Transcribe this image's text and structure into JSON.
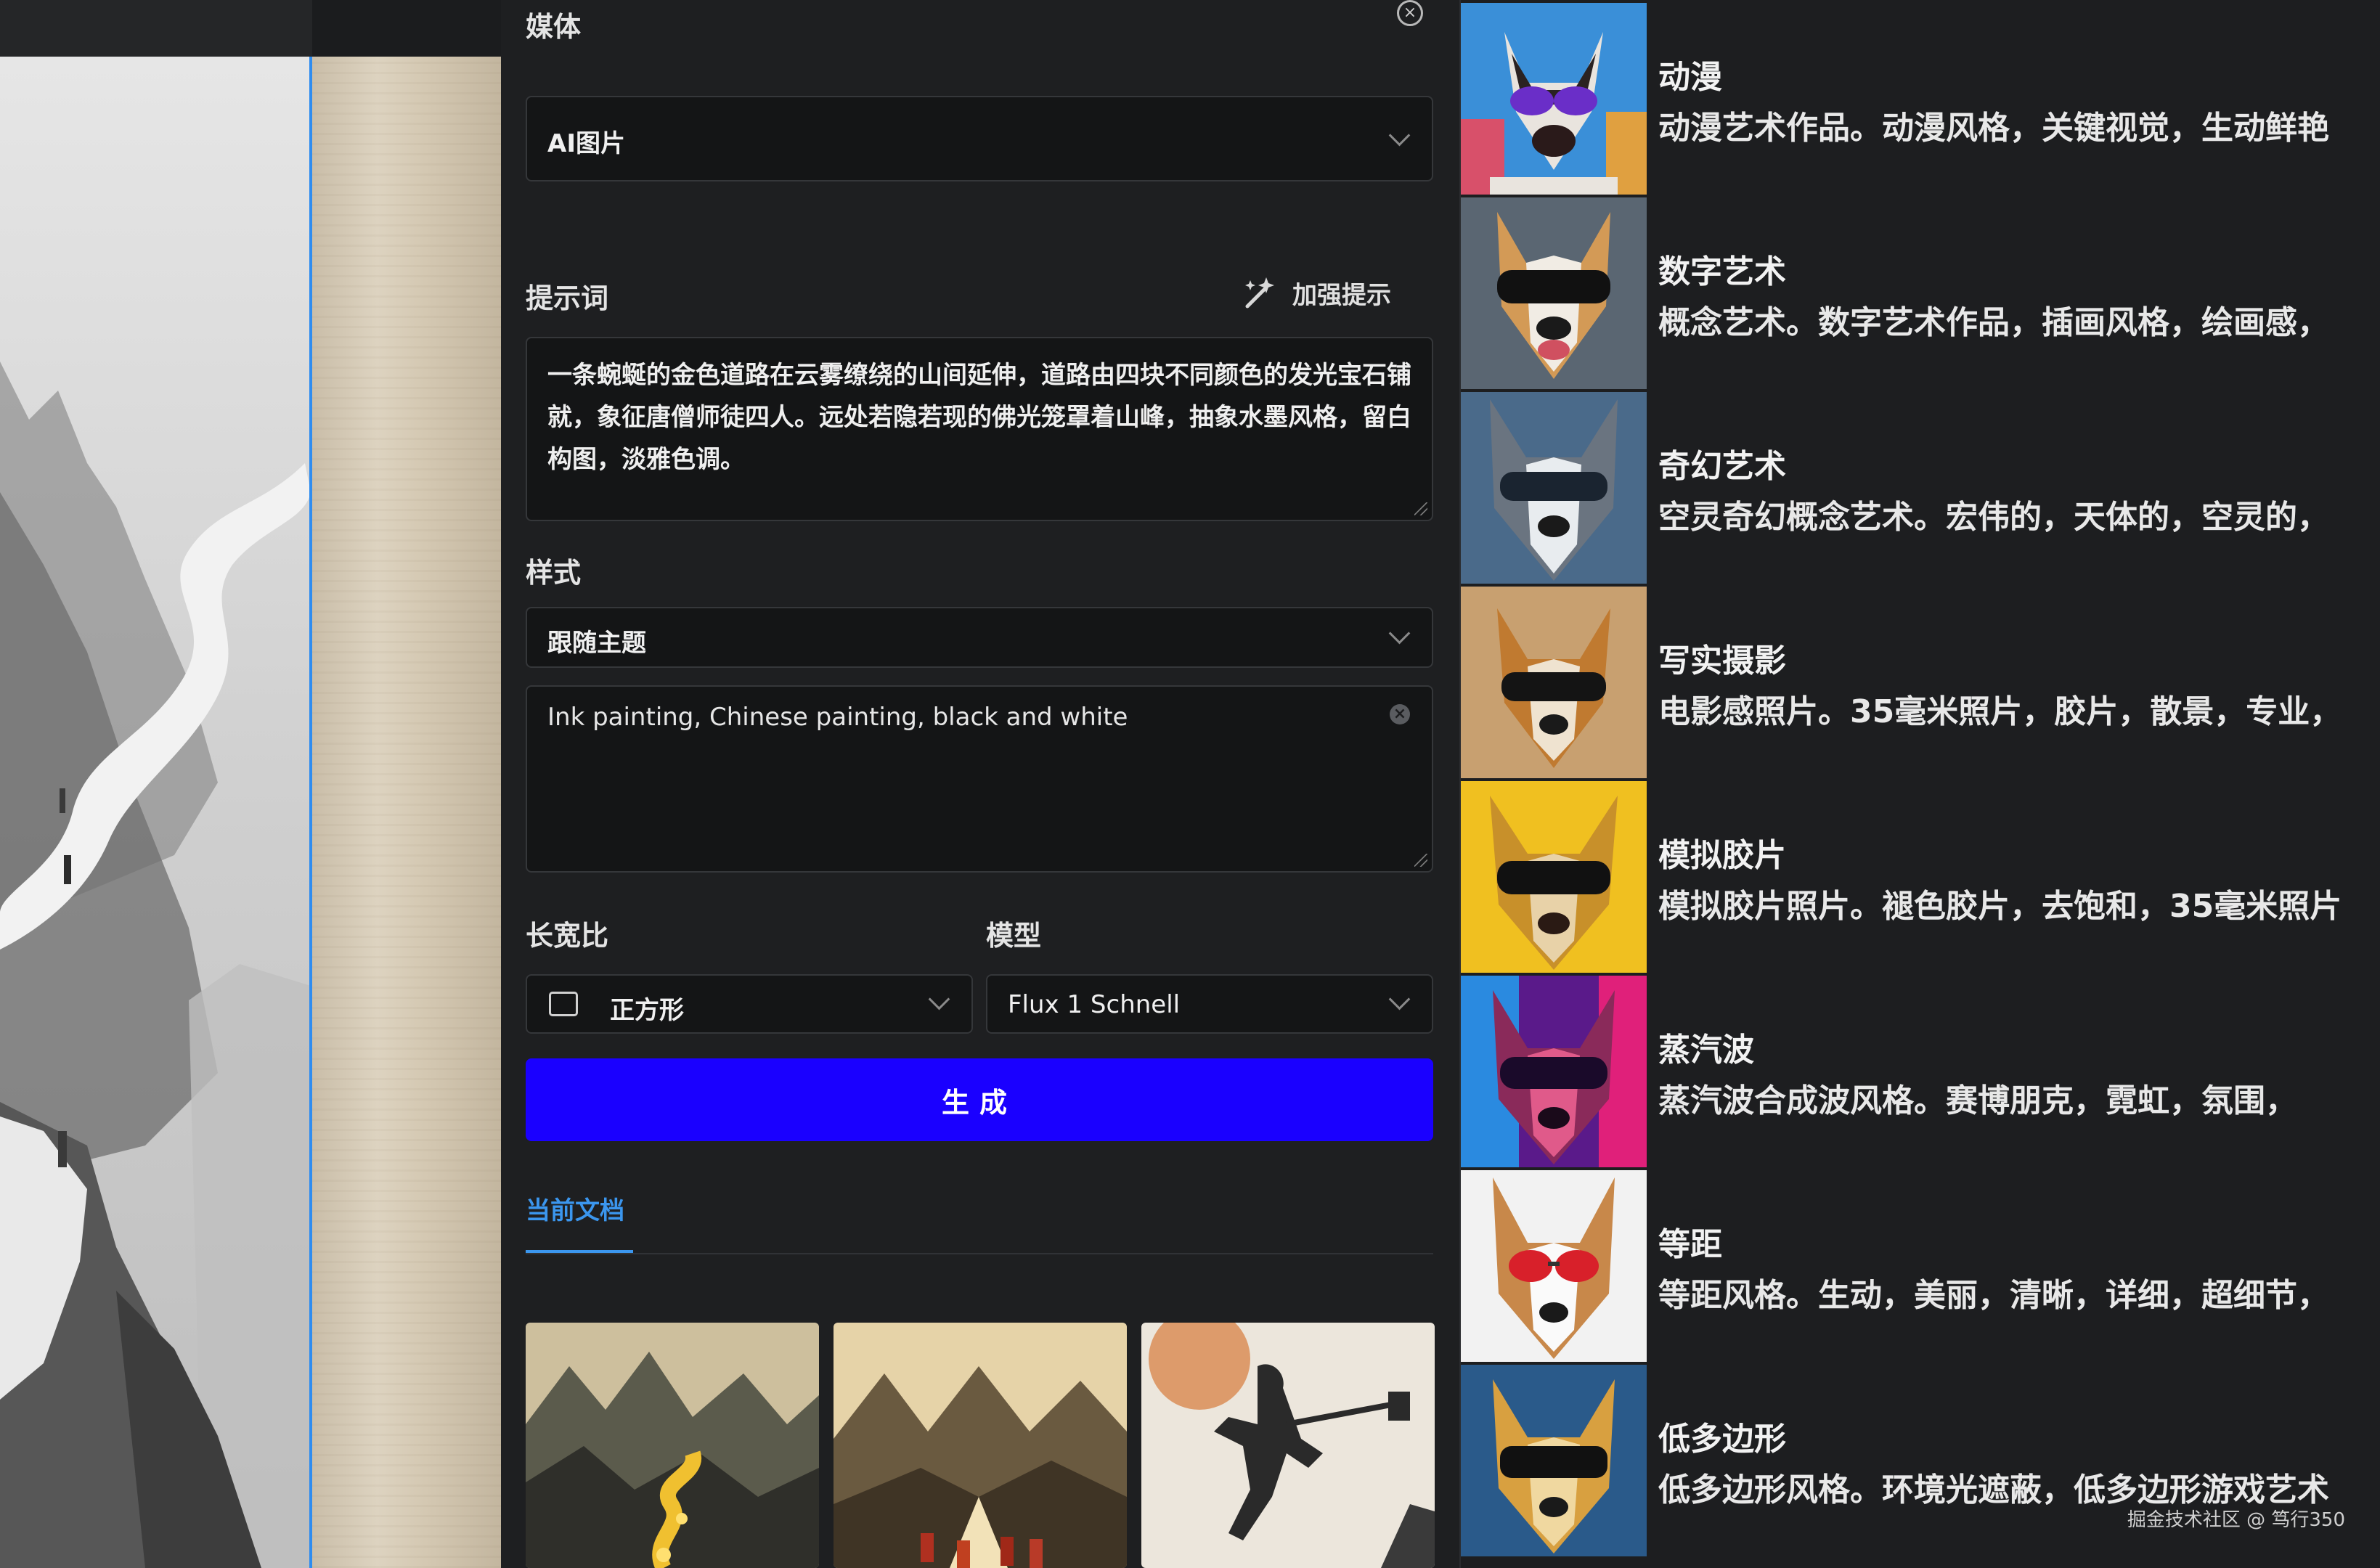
{
  "panel": {
    "media_label": "媒体",
    "media_value": "AI图片",
    "prompt_label": "提示词",
    "enhance_label": "加强提示",
    "prompt_value": "一条蜿蜒的金色道路在云雾缭绕的山间延伸，道路由四块不同颜色的发光宝石铺就，象征唐僧师徒四人。远处若隐若现的佛光笼罩着山峰，抽象水墨风格，留白构图，淡雅色调。",
    "style_label": "样式",
    "style_value": "跟随主题",
    "style_prompt_value": "Ink painting, Chinese painting, black and white",
    "aspect_label": "长宽比",
    "aspect_value": "正方形",
    "model_label": "模型",
    "model_value": "Flux 1 Schnell",
    "generate_label": "生成",
    "tab_current_doc": "当前文档"
  },
  "styles": [
    {
      "name": "动漫",
      "desc": "动漫艺术作品。动漫风格，关键视觉，生动鲜艳"
    },
    {
      "name": "数字艺术",
      "desc": "概念艺术。数字艺术作品，插画风格，绘画感，"
    },
    {
      "name": "奇幻艺术",
      "desc": "空灵奇幻概念艺术。宏伟的，天体的，空灵的，"
    },
    {
      "name": "写实摄影",
      "desc": "电影感照片。35毫米照片，胶片，散景，专业，"
    },
    {
      "name": "模拟胶片",
      "desc": "模拟胶片照片。褪色胶片，去饱和，35毫米照片"
    },
    {
      "name": "蒸汽波",
      "desc": "蒸汽波合成波风格。赛博朋克，霓虹，氛围，"
    },
    {
      "name": "等距",
      "desc": "等距风格。生动，美丽，清晰，详细，超细节，"
    },
    {
      "name": "低多边形",
      "desc": "低多边形风格。环境光遮蔽，低多边形游戏艺术"
    }
  ],
  "watermark": "掘金技术社区 @ 笃行350",
  "colors": {
    "generate_button": "#1a00ff",
    "tab_active": "#3b96ee",
    "selection": "#2e8cf0"
  }
}
